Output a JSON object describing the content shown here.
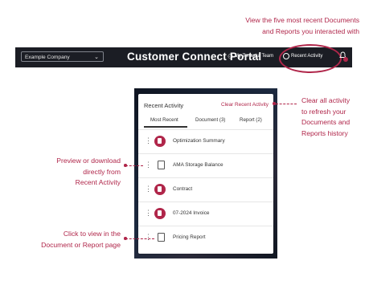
{
  "annotations": {
    "recent_activity_note": [
      "View the five most recent Documents",
      "and Reports you interacted with"
    ],
    "clear_note": [
      "Clear all activity",
      "to refresh your",
      "Documents and",
      "Reports history"
    ],
    "preview_note": [
      "Preview or download",
      "directly from",
      "Recent Activity"
    ],
    "click_note": [
      "Click to view in the",
      "Document or Report page"
    ]
  },
  "navbar": {
    "company_select": "Example Company",
    "title": "Customer Connect Portal",
    "team_link": "My Tenaska Team",
    "recent_activity_button": "Recent Activity"
  },
  "panel": {
    "title": "Recent Activity",
    "clear_link": "Clear Recent Activity",
    "tabs": [
      "Most Recent",
      "Document (3)",
      "Report (2)"
    ],
    "items": [
      {
        "label": "Optimization Summary",
        "kind": "document"
      },
      {
        "label": "AMA Storage Balance",
        "kind": "report"
      },
      {
        "label": "Contract",
        "kind": "document"
      },
      {
        "label": "07-2024 Invoice",
        "kind": "document"
      },
      {
        "label": "Pricing Report",
        "kind": "report"
      }
    ]
  },
  "colors": {
    "accent": "#b0264a",
    "nav_bg": "#1b1d24"
  }
}
